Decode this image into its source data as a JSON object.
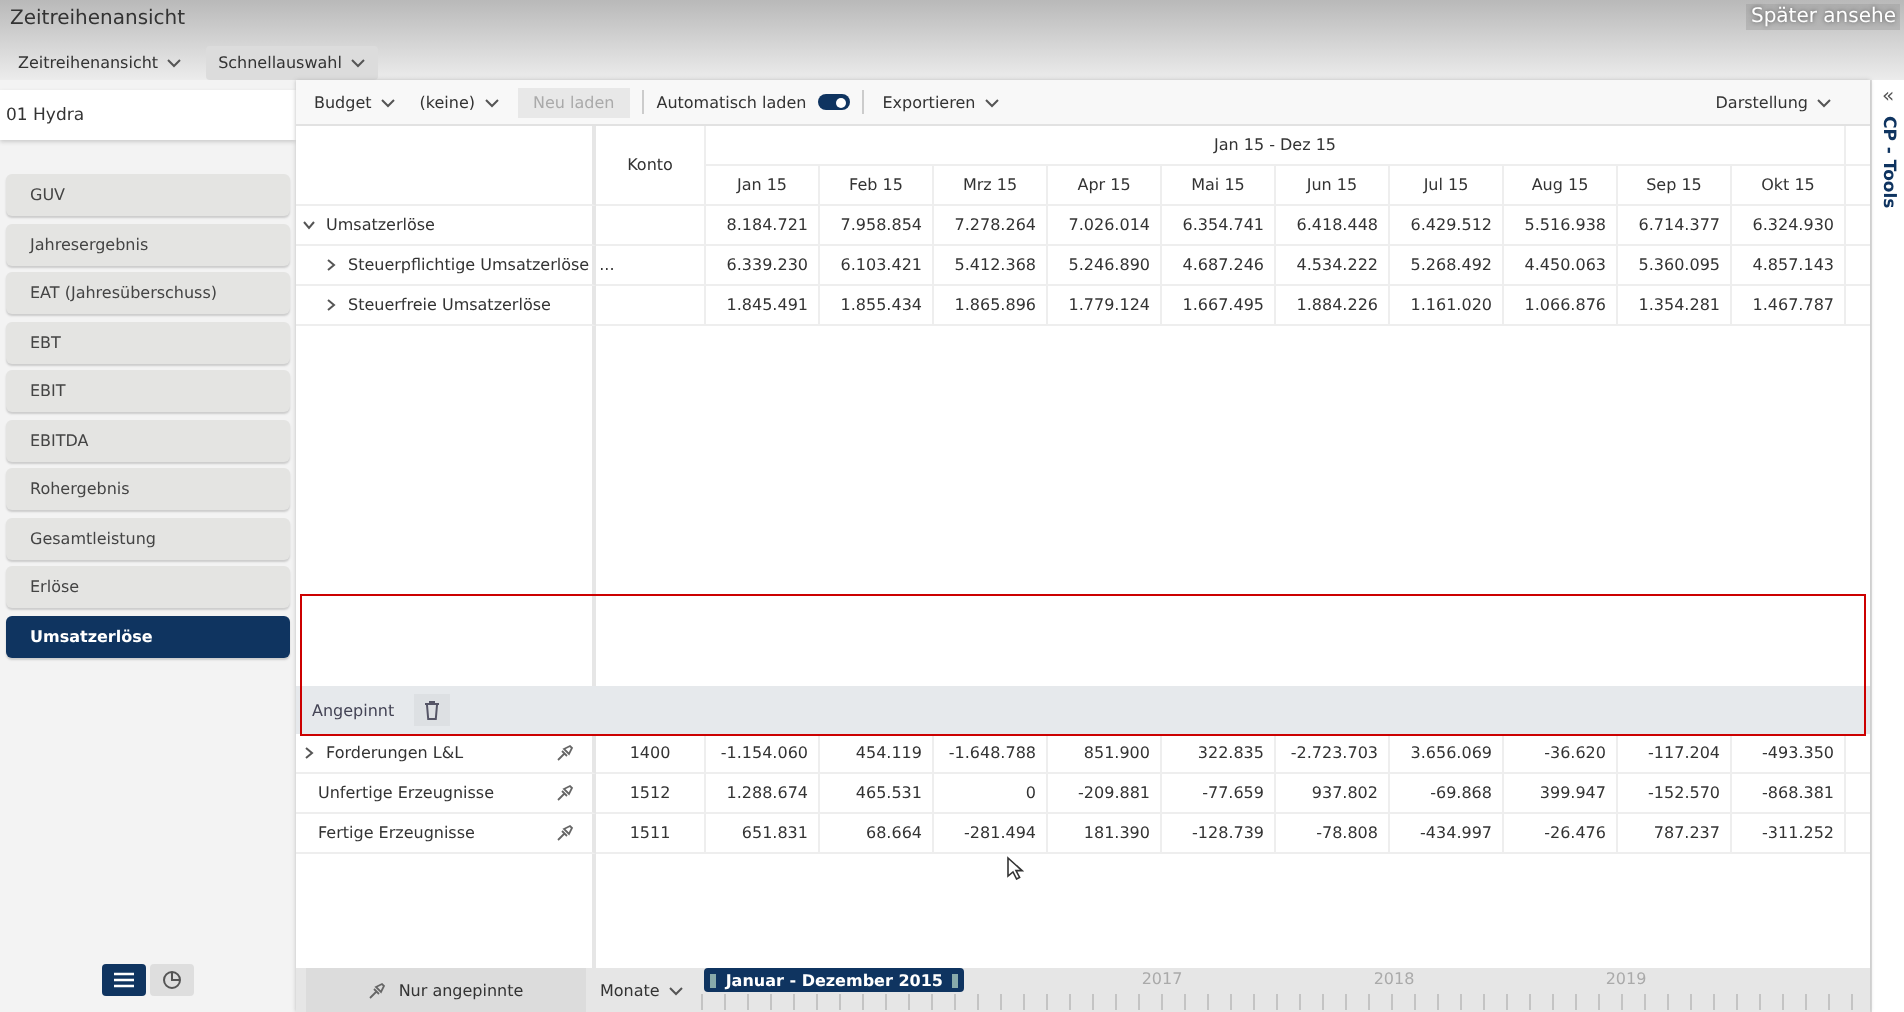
{
  "window": {
    "title": "Zeitreihenansicht",
    "overlay_text": "Später ansehe"
  },
  "view_menus": [
    {
      "label": "Zeitreihenansicht",
      "selected": false
    },
    {
      "label": "Schnellauswahl",
      "selected": true
    }
  ],
  "company": "01 Hydra",
  "sidebar": {
    "items": [
      {
        "label": "GUV",
        "selected": false
      },
      {
        "label": "Jahresergebnis",
        "selected": false
      },
      {
        "label": "EAT (Jahresüberschuss)",
        "selected": false
      },
      {
        "label": "EBT",
        "selected": false
      },
      {
        "label": "EBIT",
        "selected": false
      },
      {
        "label": "EBITDA",
        "selected": false
      },
      {
        "label": "Rohergebnis",
        "selected": false
      },
      {
        "label": "Gesamtleistung",
        "selected": false
      },
      {
        "label": "Erlöse",
        "selected": false
      },
      {
        "label": "Umsatzerlöse",
        "selected": true
      }
    ],
    "view_modes": [
      {
        "kind": "list",
        "selected": true
      },
      {
        "kind": "chart",
        "selected": false
      }
    ]
  },
  "toolbar": {
    "scenario": "Budget",
    "filter": "(keine)",
    "reload": {
      "label": "Neu laden",
      "disabled": true
    },
    "auto_load": {
      "label": "Automatisch laden",
      "on": true
    },
    "export": "Exportieren",
    "display": "Darstellung"
  },
  "table": {
    "konto_header": "Konto",
    "period": "Jan 15 - Dez 15",
    "months": [
      "Jan 15",
      "Feb 15",
      "Mrz 15",
      "Apr 15",
      "Mai 15",
      "Jun 15",
      "Jul 15",
      "Aug 15",
      "Sep 15",
      "Okt 15"
    ],
    "rows": [
      {
        "label": "Umsatzerlöse",
        "expanded": true,
        "values": [
          "8.184.721",
          "7.958.854",
          "7.278.264",
          "7.026.014",
          "6.354.741",
          "6.418.448",
          "6.429.512",
          "5.516.938",
          "6.714.377",
          "6.324.930"
        ],
        "children": [
          {
            "label": "Steuerpflichtige Umsatzerlöse",
            "menu": "...",
            "expanded": false,
            "values": [
              "6.339.230",
              "6.103.421",
              "5.412.368",
              "5.246.890",
              "4.687.246",
              "4.534.222",
              "5.268.492",
              "4.450.063",
              "5.360.095",
              "4.857.143"
            ]
          },
          {
            "label": "Steuerfreie Umsatzerlöse",
            "expanded": false,
            "values": [
              "1.845.491",
              "1.855.434",
              "1.865.896",
              "1.779.124",
              "1.667.495",
              "1.884.226",
              "1.161.020",
              "1.066.876",
              "1.354.281",
              "1.467.787"
            ]
          }
        ]
      }
    ]
  },
  "pinned": {
    "title": "Angepinnt",
    "rows": [
      {
        "label": "Forderungen L&L",
        "expandable": true,
        "konto": "1400",
        "values": [
          "-1.154.060",
          "454.119",
          "-1.648.788",
          "851.900",
          "322.835",
          "-2.723.703",
          "3.656.069",
          "-36.620",
          "-117.204",
          "-493.350"
        ]
      },
      {
        "label": "Unfertige Erzeugnisse",
        "expandable": false,
        "konto": "1512",
        "values": [
          "1.288.674",
          "465.531",
          "0",
          "-209.881",
          "-77.659",
          "937.802",
          "-69.868",
          "399.947",
          "-152.570",
          "-868.381"
        ]
      },
      {
        "label": "Fertige Erzeugnisse",
        "expandable": false,
        "konto": "1511",
        "values": [
          "651.831",
          "68.664",
          "-281.494",
          "181.390",
          "-128.739",
          "-78.808",
          "-434.997",
          "-26.476",
          "787.237",
          "-311.252"
        ]
      }
    ]
  },
  "footer": {
    "pinned_only": "Nur angepinnte",
    "granularity": "Monate",
    "range": "Januar - Dezember 2015",
    "years": [
      "2017",
      "2018",
      "2019"
    ]
  },
  "tools_panel": {
    "collapse": "«",
    "title": "CP - Tools"
  },
  "annotation_frame": true
}
